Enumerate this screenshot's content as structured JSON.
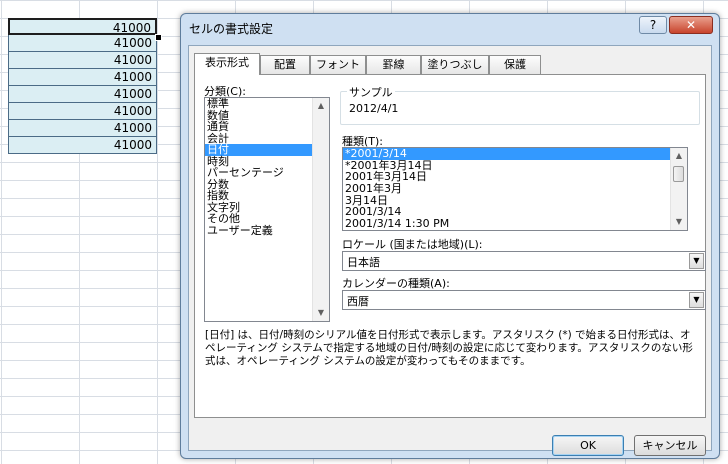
{
  "sheet": {
    "cells": [
      "41000",
      "41000",
      "41000",
      "41000",
      "41000",
      "41000",
      "41000",
      "41000"
    ]
  },
  "dialog": {
    "title": "セルの書式設定",
    "help_label": "?",
    "close_label": "✕",
    "tabs": [
      {
        "label": "表示形式"
      },
      {
        "label": "配置"
      },
      {
        "label": "フォント"
      },
      {
        "label": "罫線"
      },
      {
        "label": "塗りつぶし"
      },
      {
        "label": "保護"
      }
    ],
    "category_label": "分類(C):",
    "categories": [
      "標準",
      "数値",
      "通貨",
      "会計",
      "日付",
      "時刻",
      "パーセンテージ",
      "分数",
      "指数",
      "文字列",
      "その他",
      "ユーザー定義"
    ],
    "selected_category": "日付",
    "sample_label": "サンプル",
    "sample_value": "2012/4/1",
    "type_label": "種類(T):",
    "types": [
      "*2001/3/14",
      "*2001年3月14日",
      "2001年3月14日",
      "2001年3月",
      "3月14日",
      "2001/3/14",
      "2001/3/14 1:30 PM"
    ],
    "selected_type": "*2001/3/14",
    "locale_label": "ロケール (国または地域)(L):",
    "locale_value": "日本語",
    "calendar_label": "カレンダーの種類(A):",
    "calendar_value": "西暦",
    "description": "[日付] は、日付/時刻のシリアル値を日付形式で表示します。アスタリスク (*) で始まる日付形式は、オペレーティング システムで指定する地域の日付/時刻の設定に応じて変わります。アスタリスクのない形式は、オペレーティング システムの設定が変わってもそのままです。",
    "ok_label": "OK",
    "cancel_label": "キャンセル"
  }
}
